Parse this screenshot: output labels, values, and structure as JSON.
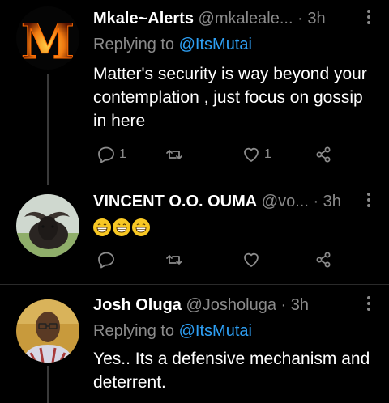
{
  "tweets": [
    {
      "name": "Mkale~Alerts",
      "handle": "@mkaleale...",
      "time": "· 3h",
      "reply_prefix": "Replying to",
      "reply_to": "@ItsMutai",
      "text": "Matter's security is way beyond your contemplation , just focus on gossip in here",
      "replies": "1",
      "retweets": "",
      "likes": "1",
      "avatar_letter": "M"
    },
    {
      "name": "VINCENT O.O. OUMA",
      "handle": "@vo...",
      "time": "· 3h",
      "emojis": [
        "grinning-face",
        "grinning-face",
        "grinning-face"
      ]
    },
    {
      "name": "Josh Oluga",
      "handle": "@Josholuga",
      "time": "· 3h",
      "reply_prefix": "Replying to",
      "reply_to": "@ItsMutai",
      "text": "Yes.. Its a defensive mechanism and deterrent."
    }
  ],
  "colors": {
    "muted": "#8b8b8b",
    "link": "#2ea0f5",
    "background": "#000000"
  },
  "icons": [
    "reply-icon",
    "retweet-icon",
    "like-icon",
    "share-icon",
    "more-icon"
  ]
}
